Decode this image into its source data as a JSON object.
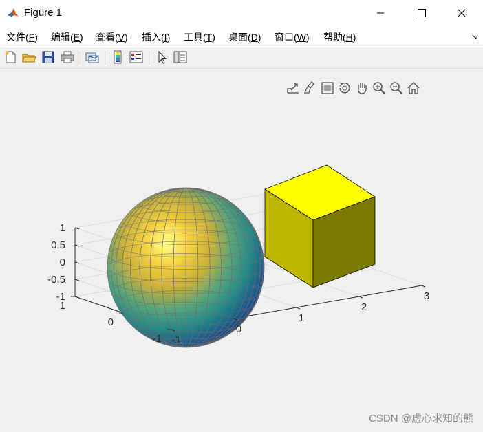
{
  "window": {
    "title": "Figure 1",
    "icons": [
      "matlab-logo-icon",
      "minimize-icon",
      "maximize-icon",
      "close-icon"
    ]
  },
  "menubar": {
    "items": [
      {
        "label": "文件(",
        "key": "F",
        "tail": ")"
      },
      {
        "label": "编辑(",
        "key": "E",
        "tail": ")"
      },
      {
        "label": "查看(",
        "key": "V",
        "tail": ")"
      },
      {
        "label": "插入(",
        "key": "I",
        "tail": ")"
      },
      {
        "label": "工具(",
        "key": "T",
        "tail": ")"
      },
      {
        "label": "桌面(",
        "key": "D",
        "tail": ")"
      },
      {
        "label": "窗口(",
        "key": "W",
        "tail": ")"
      },
      {
        "label": "帮助(",
        "key": "H",
        "tail": ")"
      }
    ],
    "dock_glyph": "↘"
  },
  "toolbar": {
    "icons": [
      "new-figure-icon",
      "open-file-icon",
      "save-icon",
      "print-icon",
      "link-plot-icon",
      "insert-colorbar-icon",
      "insert-legend-icon",
      "edit-plot-arrow-icon",
      "property-inspector-icon"
    ]
  },
  "axes_toolbar": {
    "icons": [
      "export-icon",
      "brush-icon",
      "datatip-icon",
      "rotate-3d-icon",
      "pan-icon",
      "zoom-in-icon",
      "zoom-out-icon",
      "home-icon"
    ]
  },
  "chart_data": {
    "type": "3d-surface",
    "title": "",
    "objects": [
      {
        "name": "",
        "kind": "sphere",
        "center": [
          0,
          0,
          0
        ],
        "radius": 1,
        "colormap": "parula"
      },
      {
        "name": "",
        "kind": "cube",
        "x": [
          2,
          3
        ],
        "y": [
          0,
          1
        ],
        "z": [
          0,
          1
        ],
        "color": "#ffff00"
      }
    ],
    "x_ticks": [
      "-1",
      "0",
      "1",
      "2",
      "3"
    ],
    "y_ticks": [
      "-1",
      "0",
      "1"
    ],
    "z_ticks": [
      "-1",
      "-0.5",
      "0",
      "0.5",
      "1"
    ],
    "xlim": [
      -1,
      3
    ],
    "ylim": [
      -1,
      1
    ],
    "zlim": [
      -1,
      1
    ],
    "grid": true
  },
  "watermark": "CSDN @虚心求知的熊"
}
